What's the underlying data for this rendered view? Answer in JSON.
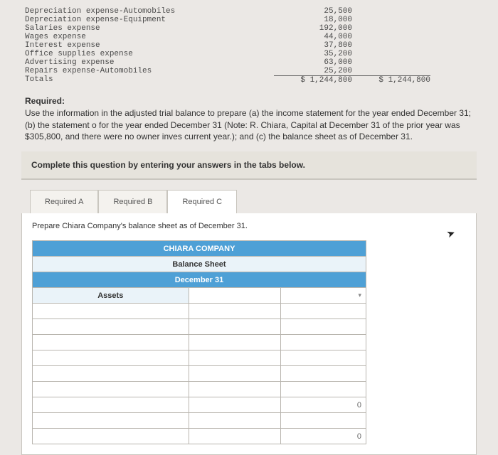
{
  "trial_balance": {
    "rows": [
      {
        "label": "Depreciation expense-Automobiles",
        "v1": "25,500",
        "v2": ""
      },
      {
        "label": "Depreciation expense-Equipment",
        "v1": "18,000",
        "v2": ""
      },
      {
        "label": "Salaries expense",
        "v1": "192,000",
        "v2": ""
      },
      {
        "label": "Wages expense",
        "v1": "44,000",
        "v2": ""
      },
      {
        "label": "Interest expense",
        "v1": "37,800",
        "v2": ""
      },
      {
        "label": "Office supplies expense",
        "v1": "35,200",
        "v2": ""
      },
      {
        "label": "Advertising expense",
        "v1": "63,000",
        "v2": ""
      },
      {
        "label": "Repairs expense-Automobiles",
        "v1": "25,200",
        "v2": ""
      }
    ],
    "totals": {
      "label": "Totals",
      "v1": "$ 1,244,800",
      "v2": "$ 1,244,800"
    }
  },
  "required": {
    "heading": "Required:",
    "text": "Use the information in the adjusted trial balance to prepare (a) the income statement for the year ended December 31; (b) the statement o for the year ended December 31 (Note: R. Chiara, Capital at December 31 of the prior year was $305,800, and there were no owner inves current year.); and (c) the balance sheet as of December 31."
  },
  "instruction": "Complete this question by entering your answers in the tabs below.",
  "tabs": {
    "a": "Required A",
    "b": "Required B",
    "c": "Required C"
  },
  "worksheet": {
    "instruction": "Prepare Chiara Company's balance sheet as of December 31.",
    "company": "CHIARA COMPANY",
    "title": "Balance Sheet",
    "date": "December 31",
    "section": "Assets",
    "zero": "0"
  }
}
